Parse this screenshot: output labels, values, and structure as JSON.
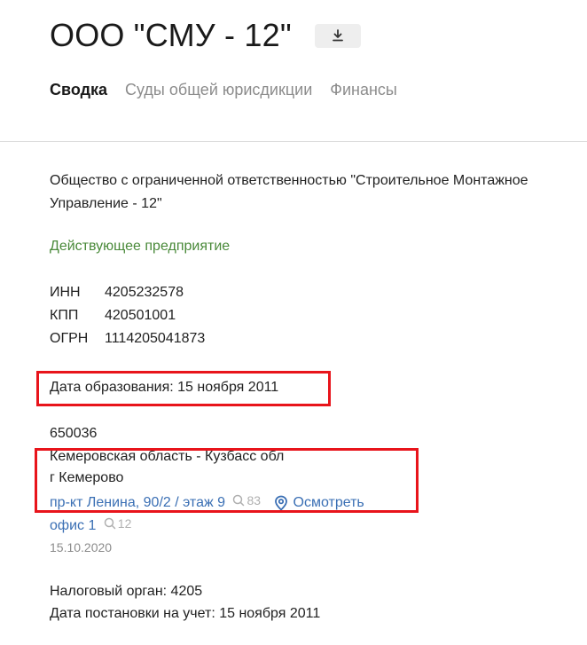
{
  "header": {
    "title": "ООО \"СМУ - 12\"",
    "download_icon": "download-icon"
  },
  "tabs": [
    {
      "label": "Сводка",
      "active": true
    },
    {
      "label": "Суды общей юрисдикции",
      "active": false
    },
    {
      "label": "Финансы",
      "active": false
    }
  ],
  "company": {
    "full_name": "Общество с ограниченной ответственностью \"Строительное Монтажное Управление - 12\"",
    "status": "Действующее предприятие",
    "requisites": [
      {
        "label": "ИНН",
        "value": "4205232578"
      },
      {
        "label": "КПП",
        "value": "420501001"
      },
      {
        "label": "ОГРН",
        "value": "1114205041873"
      }
    ],
    "founded": "Дата образования: 15 ноября 2011",
    "address": {
      "postal_code": "650036",
      "region": "Кемеровская область - Кузбасс обл",
      "city": "г Кемерово",
      "street_link": "пр-кт Ленина, 90/2 / этаж 9",
      "street_views": "83",
      "view_link": "Осмотреть",
      "office_link": "офис 1",
      "office_views": "12",
      "date": "15.10.2020"
    },
    "tax": {
      "authority": "Налоговый орган: 4205",
      "registered": "Дата постановки на учет: 15 ноября 2011"
    }
  },
  "colors": {
    "status_green": "#4a8a3a",
    "link_blue": "#3a6fb4",
    "highlight_red": "#e8141b"
  }
}
